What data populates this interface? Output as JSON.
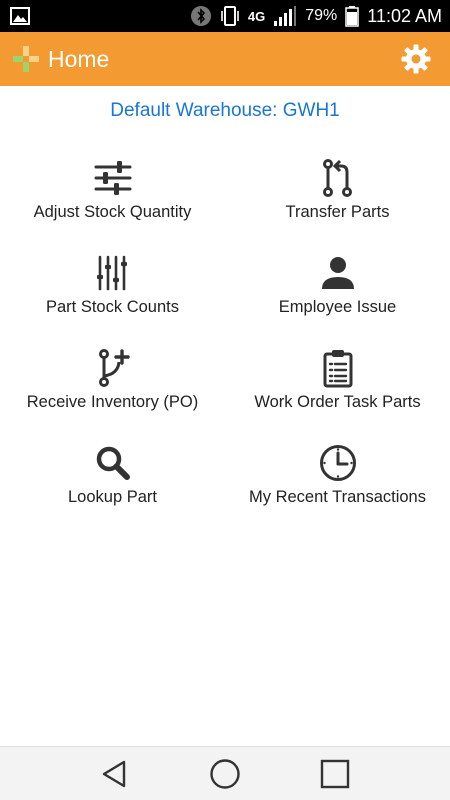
{
  "status_bar": {
    "network": "4G",
    "battery_percent": "79%",
    "time": "11:02 AM"
  },
  "app_bar": {
    "title": "Home",
    "brand_color": "#f49a32"
  },
  "warehouse_label": "Default Warehouse: GWH1",
  "menu": [
    {
      "label": "Adjust Stock Quantity",
      "icon": "sliders-icon"
    },
    {
      "label": "Transfer Parts",
      "icon": "transfer-icon"
    },
    {
      "label": "Part Stock Counts",
      "icon": "counts-icon"
    },
    {
      "label": "Employee Issue",
      "icon": "person-icon"
    },
    {
      "label": "Receive Inventory (PO)",
      "icon": "receive-icon"
    },
    {
      "label": "Work Order Task Parts",
      "icon": "clipboard-icon"
    },
    {
      "label": "Lookup Part",
      "icon": "search-icon"
    },
    {
      "label": "My Recent Transactions",
      "icon": "clock-icon"
    }
  ],
  "colors": {
    "link": "#1976d2",
    "icon": "#333333"
  }
}
